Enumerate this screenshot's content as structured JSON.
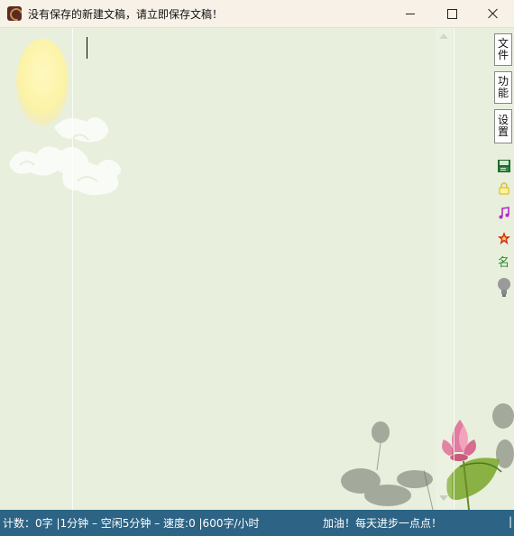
{
  "window": {
    "title": "没有保存的新建文稿，请立即保存文稿！",
    "minimize_glyph": "—",
    "maximize_glyph": "□",
    "close_glyph": "✕"
  },
  "sidebar": {
    "buttons": [
      {
        "id": "file",
        "chars": [
          "文",
          "件"
        ]
      },
      {
        "id": "function",
        "chars": [
          "功",
          "能"
        ]
      },
      {
        "id": "settings",
        "chars": [
          "设",
          "置"
        ]
      }
    ],
    "icons": [
      {
        "name": "save-icon",
        "glyph": "▤",
        "color": "#1e6b2f"
      },
      {
        "name": "lock-icon",
        "glyph": "🔒",
        "color": "#e0c020"
      },
      {
        "name": "music-icon",
        "glyph": "♫",
        "color": "#b02cc8"
      },
      {
        "name": "star-icon",
        "glyph": "★",
        "color": "#d62a1e"
      },
      {
        "name": "name-icon",
        "glyph": "名",
        "color": "#2a8a2a"
      },
      {
        "name": "bulb-icon",
        "glyph": "💡",
        "color": "#8a8a8a"
      }
    ]
  },
  "status": {
    "left": "计数：0字 |1分钟 – 空闲5分钟 – 速度:0 |600字/小时",
    "right": "加油！每天进步一点点！",
    "edge": "|"
  },
  "colors": {
    "background": "#e8efdc",
    "statusbar": "#2d6384",
    "titlebar": "#f7f1e8"
  }
}
